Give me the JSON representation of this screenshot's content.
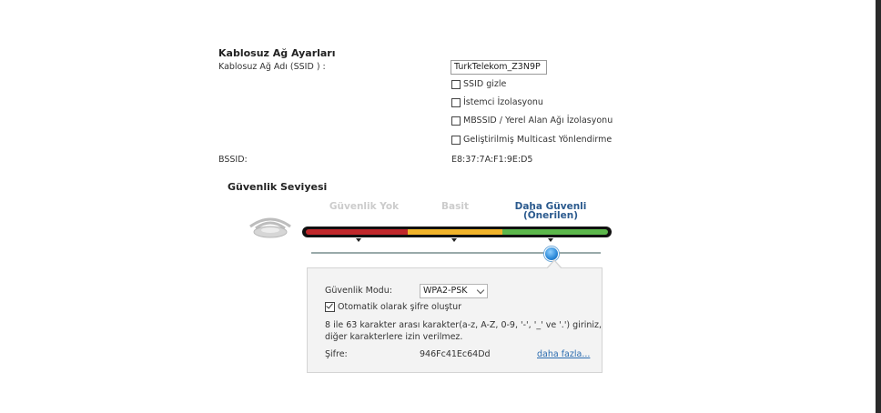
{
  "wireless": {
    "title": "Kablosuz Ağ Ayarları",
    "ssid_label": "Kablosuz Ağ Adı (SSID ) :",
    "ssid_value": "TurkTelekom_Z3N9P",
    "options": [
      {
        "label": "SSID gizle",
        "checked": false
      },
      {
        "label": "İstemci İzolasyonu",
        "checked": false
      },
      {
        "label": "MBSSID / Yerel Alan Ağı İzolasyonu",
        "checked": false
      },
      {
        "label": "Geliştirilmiş Multicast Yönlendirme",
        "checked": false
      }
    ],
    "bssid_label": "BSSID:",
    "bssid_value": "E8:37:7A:F1:9E:D5"
  },
  "security": {
    "heading": "Güvenlik Seviyesi",
    "levels": {
      "none": "Güvenlik Yok",
      "basic": "Basit",
      "secure_line1": "Daha Güvenli",
      "secure_line2": "(Önerilen)"
    },
    "selected_level": "secure",
    "colors": {
      "low": "#c0282b",
      "mid": "#f0b32a",
      "high": "#5cb74b",
      "accent": "#2b5a8e"
    },
    "panel": {
      "mode_label": "Güvenlik Modu:",
      "mode_value": "WPA2-PSK",
      "auto_password_label": "Otomatik olarak şifre oluştur",
      "auto_password_checked": true,
      "hint_line1": "8 ile 63 karakter arası karakter(a-z, A-Z, 0-9, '-', '_' ve '.') giriniz,",
      "hint_line2": "diğer karakterlere izin verilmez.",
      "password_label": "Şifre:",
      "password_value": "946Fc41Ec64Dd",
      "more_link": "daha fazla..."
    },
    "icon": "wifi-router-icon"
  }
}
